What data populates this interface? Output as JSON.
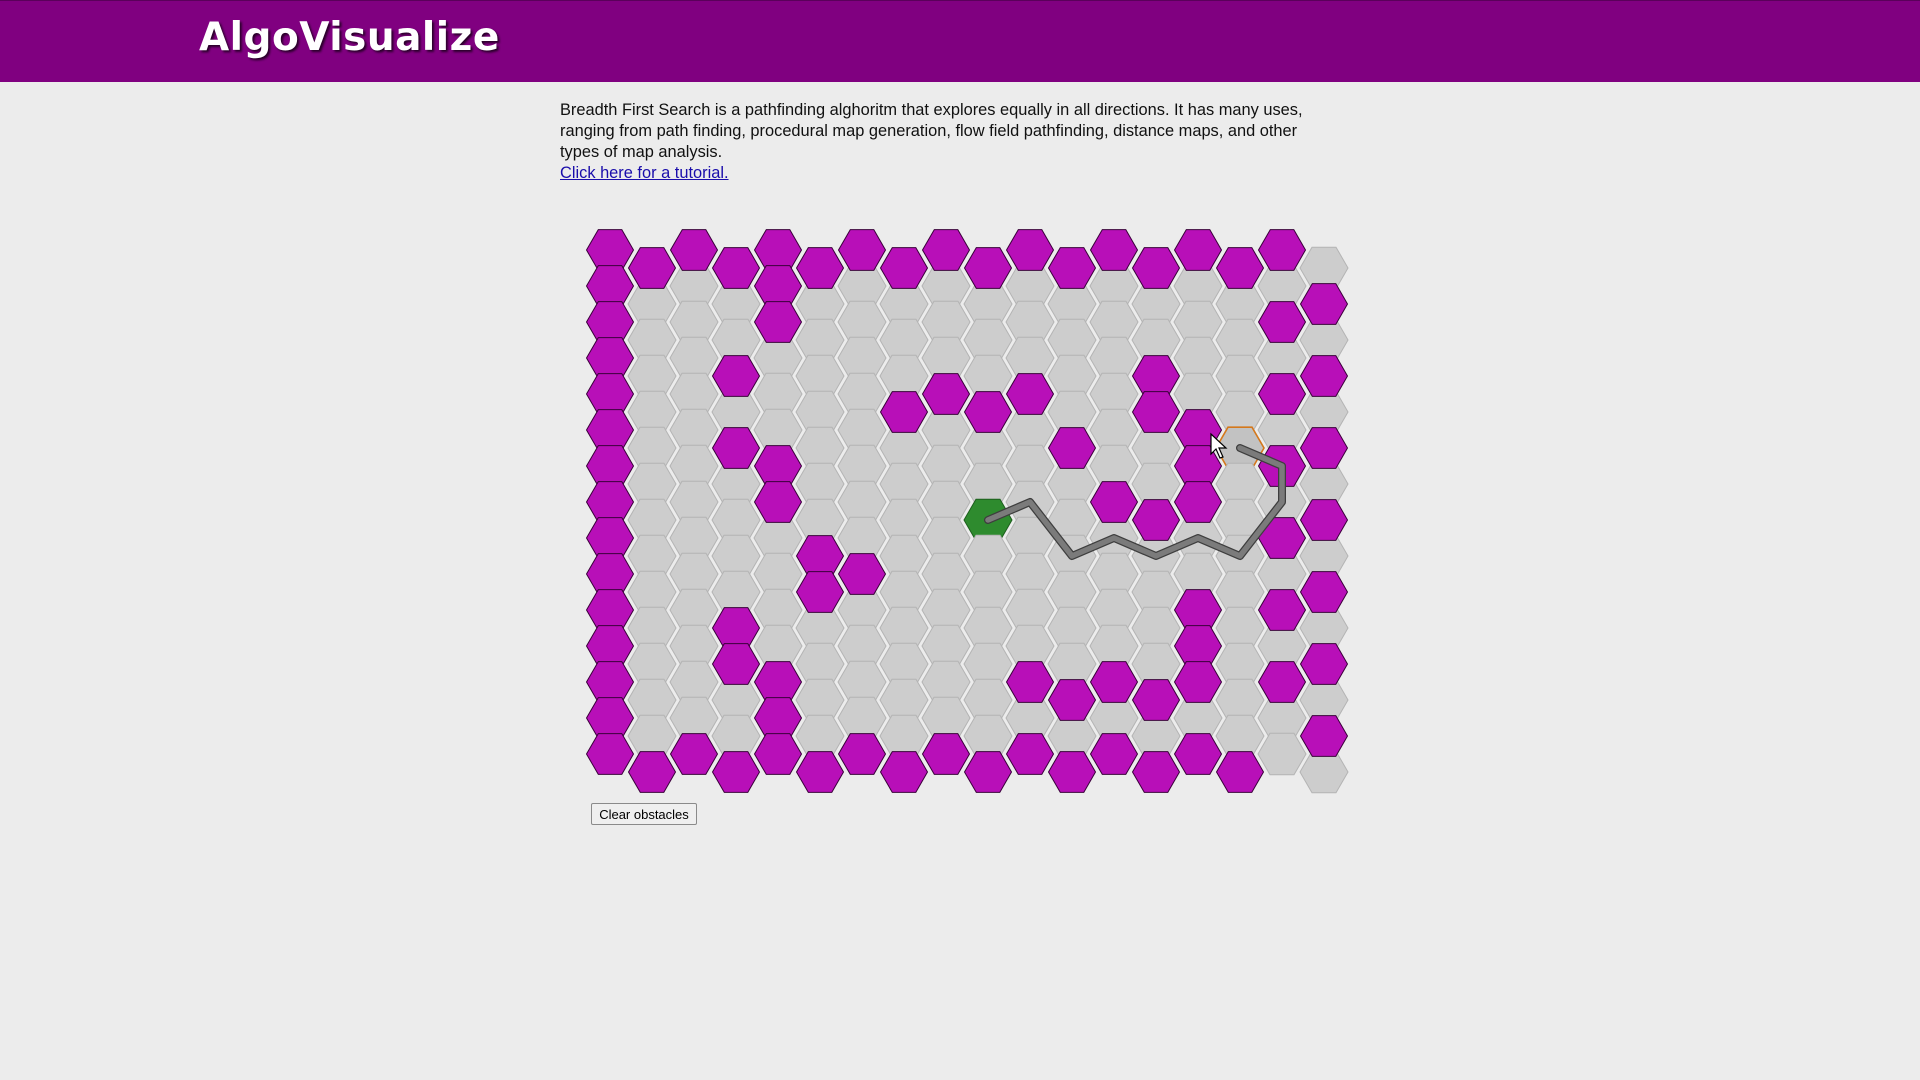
{
  "app": {
    "title": "AlgoVisualize"
  },
  "intro": {
    "description": "Breadth First Search is a pathfinding alghoritm that explores equally in all directions. It has many uses, ranging from path finding, procedural map generation, flow field pathfinding, distance maps, and other types of map analysis.",
    "tutorial_link": "Click here for a tutorial."
  },
  "controls": {
    "clear_label": "Clear obstacles"
  },
  "grid": {
    "cols": 18,
    "rows": 15,
    "obstacles": [
      [
        0,
        0
      ],
      [
        1,
        0
      ],
      [
        2,
        0
      ],
      [
        3,
        0
      ],
      [
        4,
        0
      ],
      [
        5,
        0
      ],
      [
        6,
        0
      ],
      [
        7,
        0
      ],
      [
        8,
        0
      ],
      [
        9,
        0
      ],
      [
        10,
        0
      ],
      [
        11,
        0
      ],
      [
        12,
        0
      ],
      [
        13,
        0
      ],
      [
        14,
        0
      ],
      [
        15,
        0
      ],
      [
        16,
        0
      ],
      [
        0,
        1
      ],
      [
        4,
        1
      ],
      [
        17,
        1
      ],
      [
        0,
        2
      ],
      [
        4,
        2
      ],
      [
        16,
        2
      ],
      [
        0,
        3
      ],
      [
        3,
        3
      ],
      [
        13,
        3
      ],
      [
        17,
        3
      ],
      [
        0,
        4
      ],
      [
        7,
        4
      ],
      [
        8,
        4
      ],
      [
        9,
        4
      ],
      [
        10,
        4
      ],
      [
        13,
        4
      ],
      [
        16,
        4
      ],
      [
        0,
        5
      ],
      [
        3,
        5
      ],
      [
        11,
        5
      ],
      [
        14,
        5
      ],
      [
        17,
        5
      ],
      [
        0,
        6
      ],
      [
        4,
        6
      ],
      [
        14,
        6
      ],
      [
        16,
        6
      ],
      [
        0,
        7
      ],
      [
        4,
        7
      ],
      [
        12,
        7
      ],
      [
        13,
        7
      ],
      [
        14,
        7
      ],
      [
        17,
        7
      ],
      [
        0,
        8
      ],
      [
        5,
        8
      ],
      [
        16,
        8
      ],
      [
        0,
        9
      ],
      [
        5,
        9
      ],
      [
        6,
        9
      ],
      [
        17,
        9
      ],
      [
        0,
        10
      ],
      [
        3,
        10
      ],
      [
        14,
        10
      ],
      [
        16,
        10
      ],
      [
        0,
        11
      ],
      [
        3,
        11
      ],
      [
        14,
        11
      ],
      [
        17,
        11
      ],
      [
        0,
        12
      ],
      [
        4,
        12
      ],
      [
        10,
        12
      ],
      [
        11,
        12
      ],
      [
        12,
        12
      ],
      [
        13,
        12
      ],
      [
        14,
        12
      ],
      [
        16,
        12
      ],
      [
        0,
        13
      ],
      [
        4,
        13
      ],
      [
        17,
        13
      ],
      [
        0,
        14
      ],
      [
        1,
        14
      ],
      [
        2,
        14
      ],
      [
        3,
        14
      ],
      [
        4,
        14
      ],
      [
        5,
        14
      ],
      [
        6,
        14
      ],
      [
        7,
        14
      ],
      [
        8,
        14
      ],
      [
        9,
        14
      ],
      [
        10,
        14
      ],
      [
        11,
        14
      ],
      [
        12,
        14
      ],
      [
        13,
        14
      ],
      [
        14,
        14
      ],
      [
        15,
        14
      ]
    ],
    "start": [
      9,
      7
    ],
    "goal": [
      15,
      5
    ],
    "path": [
      [
        9,
        7
      ],
      [
        10,
        7
      ],
      [
        11,
        8
      ],
      [
        12,
        8
      ],
      [
        13,
        8
      ],
      [
        14,
        8
      ],
      [
        15,
        8
      ],
      [
        16,
        7
      ],
      [
        16,
        6
      ],
      [
        15,
        5
      ]
    ],
    "colors": {
      "empty": "#cdcdcd",
      "empty_stroke": "#b4b4b4",
      "obstacle": "#b80fb8",
      "obstacle_stroke": "#3a003a",
      "start": "#2e8b2e",
      "goal": "#c2c2c2",
      "goal_stroke": "#d4781c",
      "path": "#7b7b7b",
      "path_stroke": "#3e3e3e"
    }
  }
}
